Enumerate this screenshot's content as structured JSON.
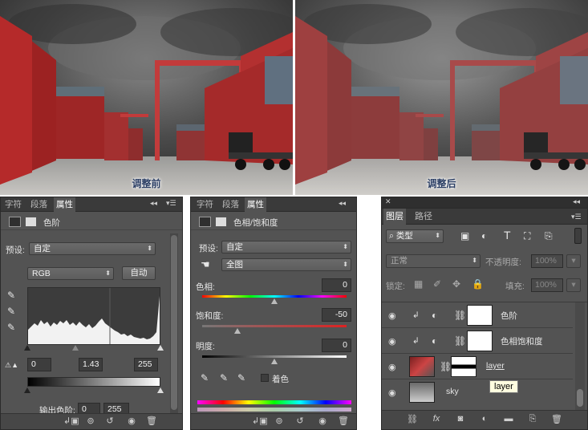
{
  "photos": {
    "before_caption": "调整前",
    "after_caption": "调整后"
  },
  "levels_panel": {
    "tabs": [
      "字符",
      "段落",
      "属性"
    ],
    "title": "色阶",
    "preset_label": "预设:",
    "preset_value": "自定",
    "channel_value": "RGB",
    "auto_button": "自动",
    "input_black": "0",
    "input_gamma": "1.43",
    "input_white": "255",
    "output_label": "输出色阶:",
    "output_black": "0",
    "output_white": "255"
  },
  "hue_sat_panel": {
    "tabs": [
      "字符",
      "段落",
      "属性"
    ],
    "title": "色相/饱和度",
    "preset_label": "预设:",
    "preset_value": "自定",
    "range_value": "全图",
    "hue_label": "色相:",
    "hue_value": "0",
    "saturation_label": "饱和度:",
    "saturation_value": "-50",
    "lightness_label": "明度:",
    "lightness_value": "0",
    "colorize_label": "着色"
  },
  "layers_panel": {
    "tabs": [
      "图层",
      "路径"
    ],
    "filter_kind": "类型",
    "blend_mode": "正常",
    "opacity_label": "不透明度:",
    "opacity_value": "100%",
    "lock_label": "锁定:",
    "fill_label": "填充:",
    "fill_value": "100%",
    "layers": [
      {
        "name": "色阶"
      },
      {
        "name": "色相饱和度"
      },
      {
        "name": "layer"
      },
      {
        "name": "sky"
      }
    ],
    "tooltip": "layer"
  }
}
